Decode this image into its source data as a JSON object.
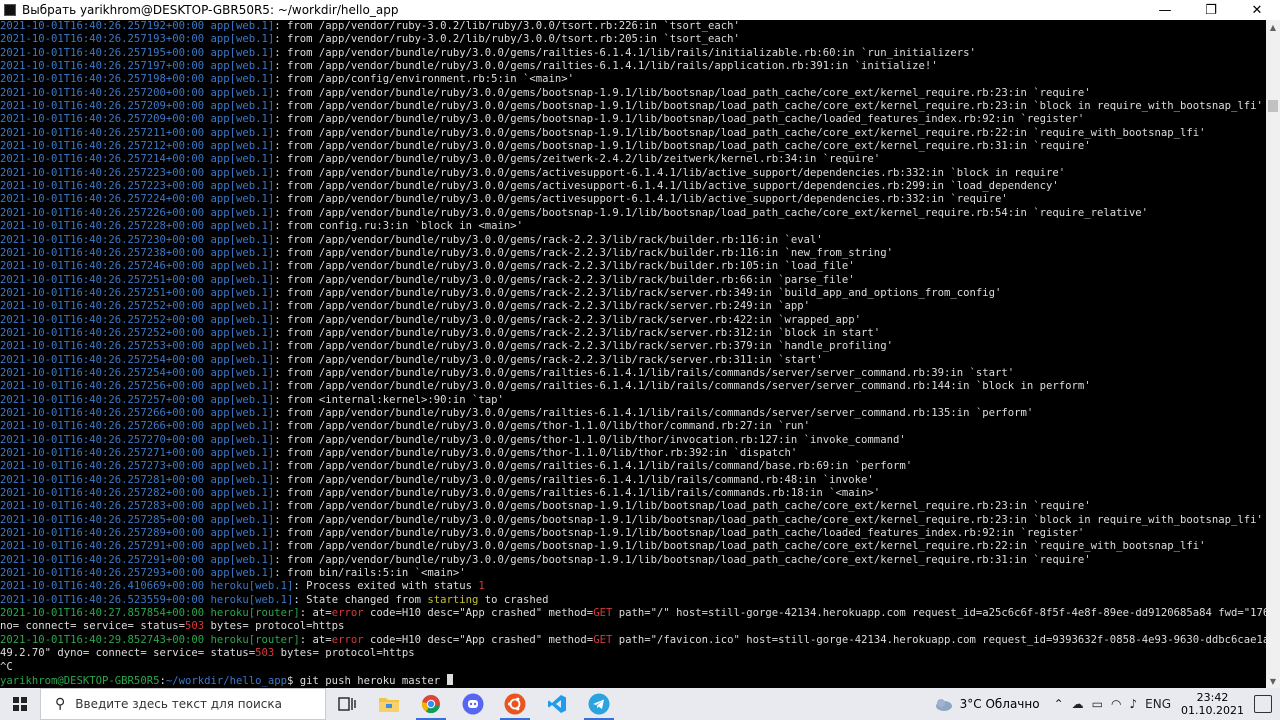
{
  "window": {
    "title": "Выбрать yarikhrom@DESKTOP-GBR50R5: ~/workdir/hello_app",
    "minimize_glyph": "—",
    "maximize_glyph": "❐",
    "close_glyph": "✕"
  },
  "terminal": {
    "trace_lines": [
      {
        "ts": "2021-10-01T16:40:26.257192+00:00",
        "src": "app[web.1]",
        "text": ": from /app/vendor/ruby-3.0.2/lib/ruby/3.0.0/tsort.rb:226:in `tsort_each'"
      },
      {
        "ts": "2021-10-01T16:40:26.257193+00:00",
        "src": "app[web.1]",
        "text": ": from /app/vendor/ruby-3.0.2/lib/ruby/3.0.0/tsort.rb:205:in `tsort_each'"
      },
      {
        "ts": "2021-10-01T16:40:26.257195+00:00",
        "src": "app[web.1]",
        "text": ": from /app/vendor/bundle/ruby/3.0.0/gems/railties-6.1.4.1/lib/rails/initializable.rb:60:in `run_initializers'"
      },
      {
        "ts": "2021-10-01T16:40:26.257197+00:00",
        "src": "app[web.1]",
        "text": ": from /app/vendor/bundle/ruby/3.0.0/gems/railties-6.1.4.1/lib/rails/application.rb:391:in `initialize!'"
      },
      {
        "ts": "2021-10-01T16:40:26.257198+00:00",
        "src": "app[web.1]",
        "text": ": from /app/config/environment.rb:5:in `<main>'"
      },
      {
        "ts": "2021-10-01T16:40:26.257200+00:00",
        "src": "app[web.1]",
        "text": ": from /app/vendor/bundle/ruby/3.0.0/gems/bootsnap-1.9.1/lib/bootsnap/load_path_cache/core_ext/kernel_require.rb:23:in `require'"
      },
      {
        "ts": "2021-10-01T16:40:26.257209+00:00",
        "src": "app[web.1]",
        "text": ": from /app/vendor/bundle/ruby/3.0.0/gems/bootsnap-1.9.1/lib/bootsnap/load_path_cache/core_ext/kernel_require.rb:23:in `block in require_with_bootsnap_lfi'"
      },
      {
        "ts": "2021-10-01T16:40:26.257209+00:00",
        "src": "app[web.1]",
        "text": ": from /app/vendor/bundle/ruby/3.0.0/gems/bootsnap-1.9.1/lib/bootsnap/load_path_cache/loaded_features_index.rb:92:in `register'"
      },
      {
        "ts": "2021-10-01T16:40:26.257211+00:00",
        "src": "app[web.1]",
        "text": ": from /app/vendor/bundle/ruby/3.0.0/gems/bootsnap-1.9.1/lib/bootsnap/load_path_cache/core_ext/kernel_require.rb:22:in `require_with_bootsnap_lfi'"
      },
      {
        "ts": "2021-10-01T16:40:26.257212+00:00",
        "src": "app[web.1]",
        "text": ": from /app/vendor/bundle/ruby/3.0.0/gems/bootsnap-1.9.1/lib/bootsnap/load_path_cache/core_ext/kernel_require.rb:31:in `require'"
      },
      {
        "ts": "2021-10-01T16:40:26.257214+00:00",
        "src": "app[web.1]",
        "text": ": from /app/vendor/bundle/ruby/3.0.0/gems/zeitwerk-2.4.2/lib/zeitwerk/kernel.rb:34:in `require'"
      },
      {
        "ts": "2021-10-01T16:40:26.257223+00:00",
        "src": "app[web.1]",
        "text": ": from /app/vendor/bundle/ruby/3.0.0/gems/activesupport-6.1.4.1/lib/active_support/dependencies.rb:332:in `block in require'"
      },
      {
        "ts": "2021-10-01T16:40:26.257223+00:00",
        "src": "app[web.1]",
        "text": ": from /app/vendor/bundle/ruby/3.0.0/gems/activesupport-6.1.4.1/lib/active_support/dependencies.rb:299:in `load_dependency'"
      },
      {
        "ts": "2021-10-01T16:40:26.257224+00:00",
        "src": "app[web.1]",
        "text": ": from /app/vendor/bundle/ruby/3.0.0/gems/activesupport-6.1.4.1/lib/active_support/dependencies.rb:332:in `require'"
      },
      {
        "ts": "2021-10-01T16:40:26.257226+00:00",
        "src": "app[web.1]",
        "text": ": from /app/vendor/bundle/ruby/3.0.0/gems/bootsnap-1.9.1/lib/bootsnap/load_path_cache/core_ext/kernel_require.rb:54:in `require_relative'"
      },
      {
        "ts": "2021-10-01T16:40:26.257228+00:00",
        "src": "app[web.1]",
        "text": ": from config.ru:3:in `block in <main>'"
      },
      {
        "ts": "2021-10-01T16:40:26.257230+00:00",
        "src": "app[web.1]",
        "text": ": from /app/vendor/bundle/ruby/3.0.0/gems/rack-2.2.3/lib/rack/builder.rb:116:in `eval'"
      },
      {
        "ts": "2021-10-01T16:40:26.257238+00:00",
        "src": "app[web.1]",
        "text": ": from /app/vendor/bundle/ruby/3.0.0/gems/rack-2.2.3/lib/rack/builder.rb:116:in `new_from_string'"
      },
      {
        "ts": "2021-10-01T16:40:26.257246+00:00",
        "src": "app[web.1]",
        "text": ": from /app/vendor/bundle/ruby/3.0.0/gems/rack-2.2.3/lib/rack/builder.rb:105:in `load_file'"
      },
      {
        "ts": "2021-10-01T16:40:26.257251+00:00",
        "src": "app[web.1]",
        "text": ": from /app/vendor/bundle/ruby/3.0.0/gems/rack-2.2.3/lib/rack/builder.rb:66:in `parse_file'"
      },
      {
        "ts": "2021-10-01T16:40:26.257251+00:00",
        "src": "app[web.1]",
        "text": ": from /app/vendor/bundle/ruby/3.0.0/gems/rack-2.2.3/lib/rack/server.rb:349:in `build_app_and_options_from_config'"
      },
      {
        "ts": "2021-10-01T16:40:26.257252+00:00",
        "src": "app[web.1]",
        "text": ": from /app/vendor/bundle/ruby/3.0.0/gems/rack-2.2.3/lib/rack/server.rb:249:in `app'"
      },
      {
        "ts": "2021-10-01T16:40:26.257252+00:00",
        "src": "app[web.1]",
        "text": ": from /app/vendor/bundle/ruby/3.0.0/gems/rack-2.2.3/lib/rack/server.rb:422:in `wrapped_app'"
      },
      {
        "ts": "2021-10-01T16:40:26.257252+00:00",
        "src": "app[web.1]",
        "text": ": from /app/vendor/bundle/ruby/3.0.0/gems/rack-2.2.3/lib/rack/server.rb:312:in `block in start'"
      },
      {
        "ts": "2021-10-01T16:40:26.257253+00:00",
        "src": "app[web.1]",
        "text": ": from /app/vendor/bundle/ruby/3.0.0/gems/rack-2.2.3/lib/rack/server.rb:379:in `handle_profiling'"
      },
      {
        "ts": "2021-10-01T16:40:26.257254+00:00",
        "src": "app[web.1]",
        "text": ": from /app/vendor/bundle/ruby/3.0.0/gems/rack-2.2.3/lib/rack/server.rb:311:in `start'"
      },
      {
        "ts": "2021-10-01T16:40:26.257254+00:00",
        "src": "app[web.1]",
        "text": ": from /app/vendor/bundle/ruby/3.0.0/gems/railties-6.1.4.1/lib/rails/commands/server/server_command.rb:39:in `start'"
      },
      {
        "ts": "2021-10-01T16:40:26.257256+00:00",
        "src": "app[web.1]",
        "text": ": from /app/vendor/bundle/ruby/3.0.0/gems/railties-6.1.4.1/lib/rails/commands/server/server_command.rb:144:in `block in perform'"
      },
      {
        "ts": "2021-10-01T16:40:26.257257+00:00",
        "src": "app[web.1]",
        "text": ": from <internal:kernel>:90:in `tap'"
      },
      {
        "ts": "2021-10-01T16:40:26.257266+00:00",
        "src": "app[web.1]",
        "text": ": from /app/vendor/bundle/ruby/3.0.0/gems/railties-6.1.4.1/lib/rails/commands/server/server_command.rb:135:in `perform'"
      },
      {
        "ts": "2021-10-01T16:40:26.257266+00:00",
        "src": "app[web.1]",
        "text": ": from /app/vendor/bundle/ruby/3.0.0/gems/thor-1.1.0/lib/thor/command.rb:27:in `run'"
      },
      {
        "ts": "2021-10-01T16:40:26.257270+00:00",
        "src": "app[web.1]",
        "text": ": from /app/vendor/bundle/ruby/3.0.0/gems/thor-1.1.0/lib/thor/invocation.rb:127:in `invoke_command'"
      },
      {
        "ts": "2021-10-01T16:40:26.257271+00:00",
        "src": "app[web.1]",
        "text": ": from /app/vendor/bundle/ruby/3.0.0/gems/thor-1.1.0/lib/thor.rb:392:in `dispatch'"
      },
      {
        "ts": "2021-10-01T16:40:26.257273+00:00",
        "src": "app[web.1]",
        "text": ": from /app/vendor/bundle/ruby/3.0.0/gems/railties-6.1.4.1/lib/rails/command/base.rb:69:in `perform'"
      },
      {
        "ts": "2021-10-01T16:40:26.257281+00:00",
        "src": "app[web.1]",
        "text": ": from /app/vendor/bundle/ruby/3.0.0/gems/railties-6.1.4.1/lib/rails/command.rb:48:in `invoke'"
      },
      {
        "ts": "2021-10-01T16:40:26.257282+00:00",
        "src": "app[web.1]",
        "text": ": from /app/vendor/bundle/ruby/3.0.0/gems/railties-6.1.4.1/lib/rails/commands.rb:18:in `<main>'"
      },
      {
        "ts": "2021-10-01T16:40:26.257283+00:00",
        "src": "app[web.1]",
        "text": ": from /app/vendor/bundle/ruby/3.0.0/gems/bootsnap-1.9.1/lib/bootsnap/load_path_cache/core_ext/kernel_require.rb:23:in `require'"
      },
      {
        "ts": "2021-10-01T16:40:26.257285+00:00",
        "src": "app[web.1]",
        "text": ": from /app/vendor/bundle/ruby/3.0.0/gems/bootsnap-1.9.1/lib/bootsnap/load_path_cache/core_ext/kernel_require.rb:23:in `block in require_with_bootsnap_lfi'"
      },
      {
        "ts": "2021-10-01T16:40:26.257289+00:00",
        "src": "app[web.1]",
        "text": ": from /app/vendor/bundle/ruby/3.0.0/gems/bootsnap-1.9.1/lib/bootsnap/load_path_cache/loaded_features_index.rb:92:in `register'"
      },
      {
        "ts": "2021-10-01T16:40:26.257291+00:00",
        "src": "app[web.1]",
        "text": ": from /app/vendor/bundle/ruby/3.0.0/gems/bootsnap-1.9.1/lib/bootsnap/load_path_cache/core_ext/kernel_require.rb:22:in `require_with_bootsnap_lfi'"
      },
      {
        "ts": "2021-10-01T16:40:26.257291+00:00",
        "src": "app[web.1]",
        "text": ": from /app/vendor/bundle/ruby/3.0.0/gems/bootsnap-1.9.1/lib/bootsnap/load_path_cache/core_ext/kernel_require.rb:31:in `require'"
      },
      {
        "ts": "2021-10-01T16:40:26.257293+00:00",
        "src": "app[web.1]",
        "text": ": from bin/rails:5:in `<main>'"
      }
    ],
    "exit": {
      "ts": "2021-10-01T16:40:26.410669+00:00",
      "src": "heroku[web.1]",
      "text": ": Process exited with status ",
      "status": "1"
    },
    "state": {
      "ts": "2021-10-01T16:40:26.523559+00:00",
      "src": "heroku[web.1]",
      "pre": ": State changed from ",
      "from": "starting",
      "mid": " to crashed"
    },
    "router1": {
      "ts": "2021-10-01T16:40:27.857854+00:00",
      "src": "heroku[router]",
      "a": ": at=",
      "at": "error",
      "b": " code=H10 desc=\"App crashed\" method=",
      "method": "GET",
      "c": " path=\"/\" host=still-gorge-42134.herokuapp.com request_id=a25c6c6f-8f5f-4e8f-89ee-dd9120685a84 fwd=\"176.49.2.70\" dy",
      "d": "no= connect= service= status=",
      "status": "503",
      "e": " bytes= protocol=https"
    },
    "router2": {
      "ts": "2021-10-01T16:40:29.852743+00:00",
      "src": "heroku[router]",
      "a": ": at=",
      "at": "error",
      "b": " code=H10 desc=\"App crashed\" method=",
      "method": "GET",
      "c": " path=\"/favicon.ico\" host=still-gorge-42134.herokuapp.com request_id=9393632f-0858-4e93-9630-ddbc6cae1aed fwd=\"176.",
      "d": "49.2.70\" dyno= connect= service= status=",
      "status": "503",
      "e": " bytes= protocol=https"
    },
    "interrupt": "^C",
    "prompt_user": "yarikhrom@DESKTOP-GBR50R5",
    "prompt_sep": ":",
    "prompt_path": "~/workdir/hello_app",
    "prompt_dollar": "$ ",
    "command": "git push heroku master "
  },
  "taskbar": {
    "search_placeholder": "Введите здесь текст для поиска",
    "weather": "3°C  Облачно",
    "language": "ENG",
    "time": "23:42",
    "date": "01.10.2021",
    "apps": [
      "task-view",
      "file-explorer",
      "chrome",
      "discord",
      "ubuntu",
      "vscode",
      "telegram"
    ]
  },
  "colors": {
    "timestamp": "#3b78c8",
    "router": "#2aa84a",
    "error": "#d23b3b",
    "accent": "#3a6fd8"
  }
}
